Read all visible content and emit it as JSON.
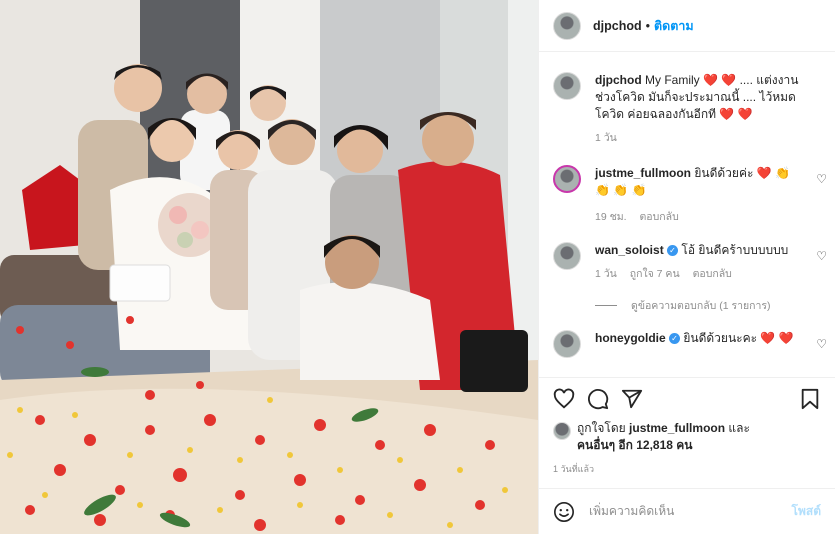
{
  "post": {
    "username": "djpchod",
    "separator": "•",
    "follow_label": "ติดตาม",
    "caption_prefix": "My Family",
    "caption_emoji": "❤️ ❤️",
    "caption_text": ".... แต่งงานช่วงโควิด มันก็จะประมาณนี้ .... ไว้หมดโควิด ค่อยฉลองกันอีกที",
    "caption_emoji_end": "❤️ ❤️",
    "caption_time": "1 วัน"
  },
  "comments": [
    {
      "username": "justme_fullmoon",
      "verified": false,
      "text": "ยินดีด้วยค่ะ",
      "emoji": "❤️ 👏 👏 👏 👏",
      "time": "19 ชม.",
      "likes": "",
      "reply_label": "ตอบกลับ"
    },
    {
      "username": "wan_soloist",
      "verified": true,
      "text": "โอ้ ยินดีคร้าบบบบบบ",
      "emoji": "",
      "time": "1 วัน",
      "likes": "ถูกใจ 7 คน",
      "reply_label": "ตอบกลับ",
      "view_replies": "ดูข้อความตอบกลับ (1 รายการ)"
    },
    {
      "username": "honeygoldie",
      "verified": true,
      "text": "ยินดีด้วยนะคะ",
      "emoji": "❤️ ❤️"
    }
  ],
  "actions": {
    "liked_by_prefix": "ถูกใจโดย",
    "liked_by_user": "justme_fullmoon",
    "liked_by_and": "และ",
    "liked_by_others": "คนอื่นๆ อีก 12,818 คน",
    "date": "1 วันที่แล้ว"
  },
  "add_comment": {
    "placeholder": "เพิ่มความคิดเห็น",
    "post_label": "โพสต์"
  },
  "icons": [
    "heart-icon",
    "comment-icon",
    "share-icon",
    "bookmark-icon",
    "emoji-icon"
  ],
  "colors": {
    "accent": "#0095f6",
    "heart": "#e0242f"
  }
}
